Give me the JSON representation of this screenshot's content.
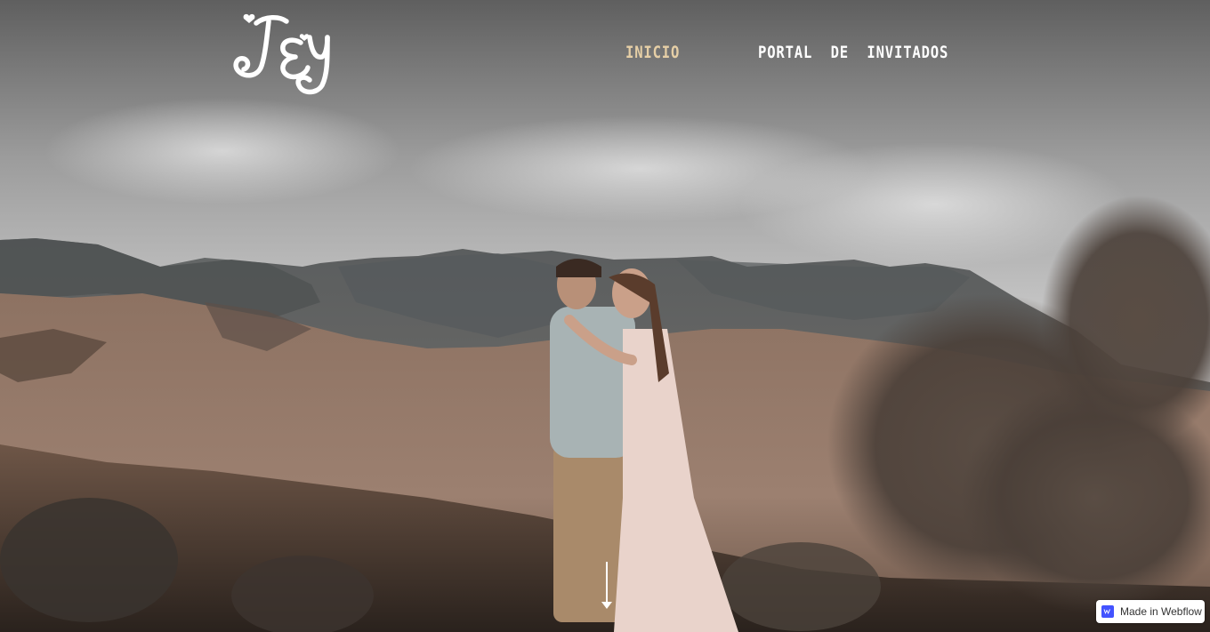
{
  "logo": {
    "icon": "monogram-logo",
    "text": "J&J"
  },
  "nav": {
    "items": [
      {
        "label": "INICIO",
        "active": true
      },
      {
        "label": "PORTAL  DE  INVITADOS",
        "active": false
      }
    ],
    "active_color": "#e6cfa6",
    "color": "#ffffff"
  },
  "hero": {
    "image": "couple-embracing-in-misty-mountains-photo",
    "scroll_indicator": "down-arrow-icon"
  },
  "badge": {
    "label": "Made in Webflow",
    "icon": "webflow-icon",
    "accent": "#4353ff"
  }
}
